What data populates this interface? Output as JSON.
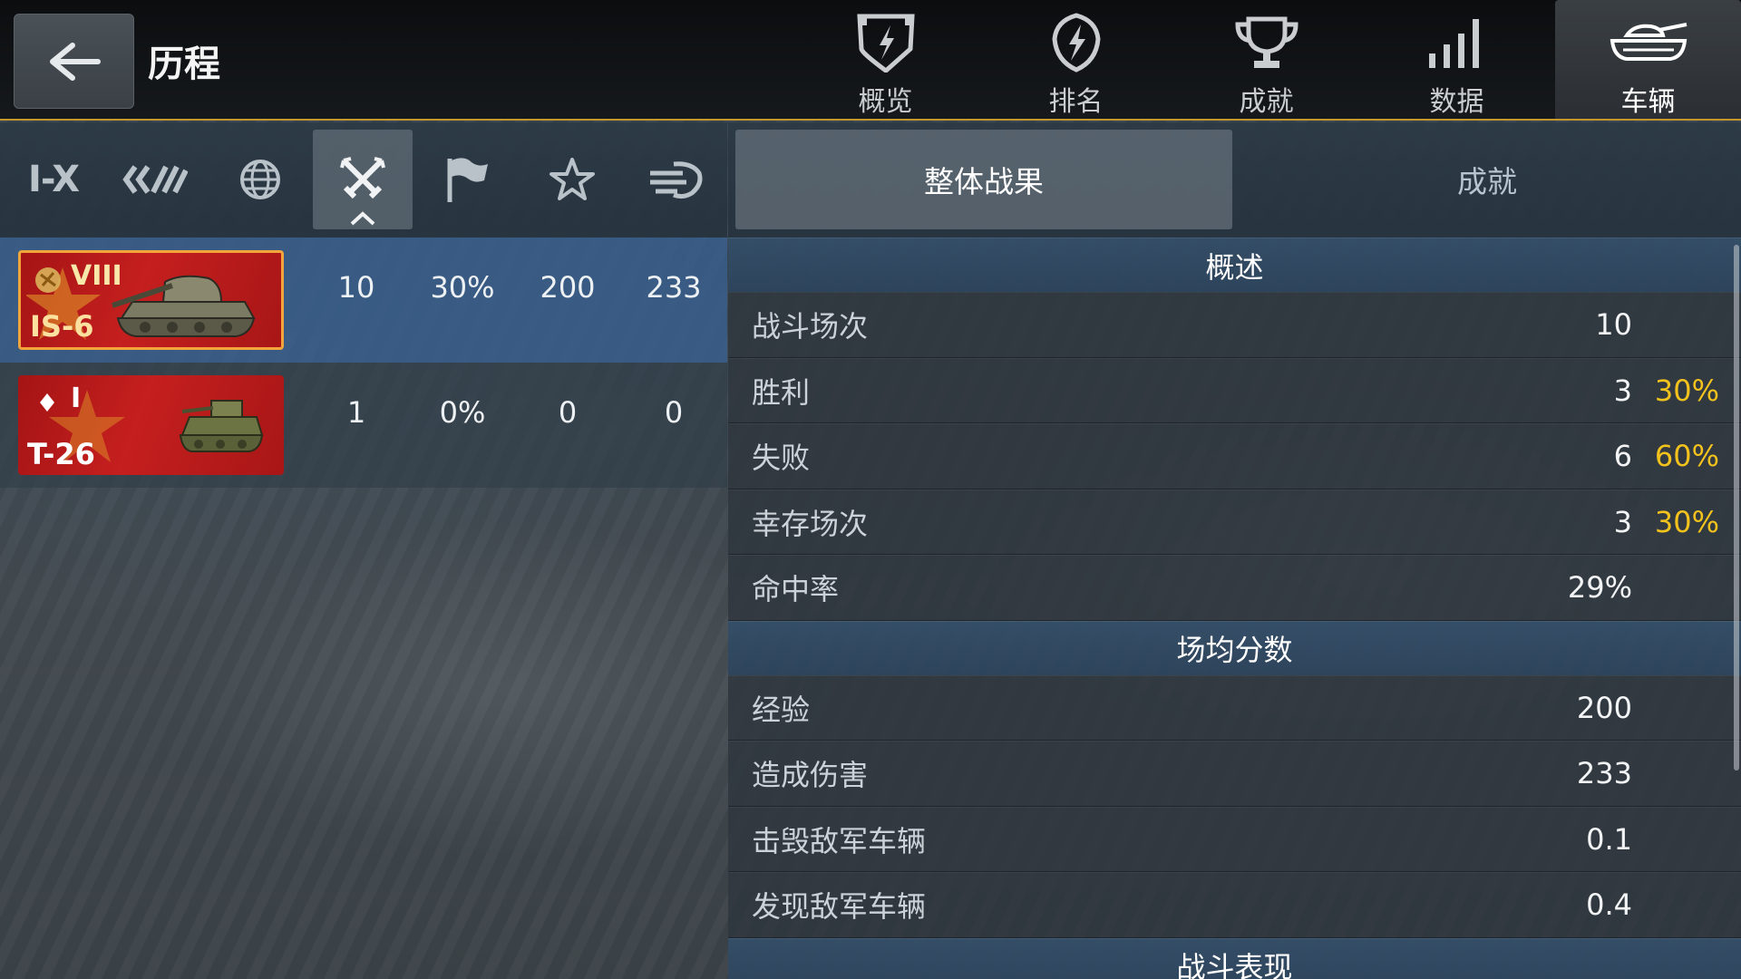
{
  "header": {
    "title": "历程",
    "nav": [
      {
        "label": "概览",
        "icon": "shield-lightning-icon"
      },
      {
        "label": "排名",
        "icon": "badge-lightning-icon"
      },
      {
        "label": "成就",
        "icon": "trophy-icon"
      },
      {
        "label": "数据",
        "icon": "signal-bars-icon"
      },
      {
        "label": "车辆",
        "icon": "tank-icon",
        "active": true
      }
    ]
  },
  "filters": {
    "tier_label": "I-X",
    "items": [
      "tier-filter",
      "nation-filter",
      "globe-filter",
      "battle-mode-filter",
      "flag-filter",
      "star-filter",
      "vehicle-type-filter"
    ],
    "active": "battle-mode-filter"
  },
  "vehicles": [
    {
      "tier": "VIII",
      "name": "IS-6",
      "stats": [
        "10",
        "30%",
        "200",
        "233"
      ],
      "selected": true
    },
    {
      "tier": "I",
      "name": "T-26",
      "stats": [
        "1",
        "0%",
        "0",
        "0"
      ],
      "selected": false
    }
  ],
  "right_tabs": [
    {
      "label": "整体战果",
      "active": true
    },
    {
      "label": "成就",
      "active": false
    }
  ],
  "sections": [
    {
      "title": "概述",
      "rows": [
        {
          "label": "战斗场次",
          "value": "10",
          "pct": ""
        },
        {
          "label": "胜利",
          "value": "3",
          "pct": "30%"
        },
        {
          "label": "失败",
          "value": "6",
          "pct": "60%"
        },
        {
          "label": "幸存场次",
          "value": "3",
          "pct": "30%"
        },
        {
          "label": "命中率",
          "value": "29%",
          "pct": ""
        }
      ]
    },
    {
      "title": "场均分数",
      "rows": [
        {
          "label": "经验",
          "value": "200",
          "pct": ""
        },
        {
          "label": "造成伤害",
          "value": "233",
          "pct": ""
        },
        {
          "label": "击毁敌军车辆",
          "value": "0.1",
          "pct": ""
        },
        {
          "label": "发现敌军车辆",
          "value": "0.4",
          "pct": ""
        }
      ]
    },
    {
      "title": "战斗表现",
      "rows": []
    }
  ],
  "colors": {
    "accent": "#c8962a",
    "highlight_pct": "#f3c21d",
    "selected_row": "#385e8c"
  }
}
